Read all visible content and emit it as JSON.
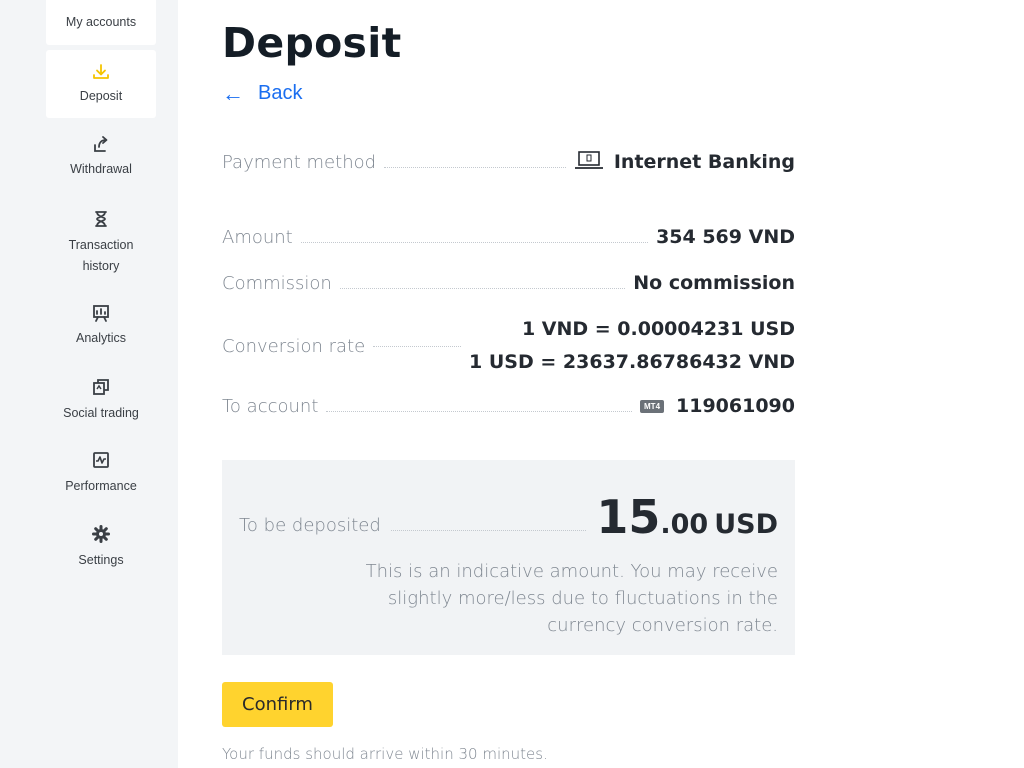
{
  "sidebar": {
    "items": [
      {
        "label": "My accounts",
        "icon": "accounts-icon"
      },
      {
        "label": "Deposit",
        "icon": "deposit-icon",
        "active": true
      },
      {
        "label": "Withdrawal",
        "icon": "withdrawal-icon"
      },
      {
        "label": "Transaction history",
        "icon": "hourglass-icon"
      },
      {
        "label": "Analytics",
        "icon": "analytics-icon"
      },
      {
        "label": "Social trading",
        "icon": "social-trading-icon"
      },
      {
        "label": "Performance",
        "icon": "performance-icon"
      },
      {
        "label": "Settings",
        "icon": "gear-icon"
      }
    ]
  },
  "page": {
    "title": "Deposit",
    "back_label": "Back"
  },
  "details": {
    "payment_method_label": "Payment method",
    "payment_method_value": "Internet Banking",
    "amount_label": "Amount",
    "amount_value": "354 569 VND",
    "commission_label": "Commission",
    "commission_value": "No commission",
    "conversion_label": "Conversion rate",
    "conversion_line1": "1 VND = 0.00004231 USD",
    "conversion_line2": "1 USD = 23637.86786432 VND",
    "to_account_label": "To account",
    "to_account_badge": "MT4",
    "to_account_value": "119061090"
  },
  "summary": {
    "label": "To be deposited",
    "amount_int": "15",
    "amount_dec": ".00",
    "currency": "USD",
    "note": "This is an indicative amount. You may receive slightly more/less due to fluctuations in the currency conversion rate."
  },
  "actions": {
    "confirm_label": "Confirm",
    "footnote": "Your funds should arrive within 30 minutes."
  },
  "colors": {
    "accent_yellow": "#ffd32e",
    "icon_yellow": "#f5c400",
    "link_blue": "#1a6ef0",
    "sidebar_bg": "#f3f5f7",
    "summary_bg": "#f1f3f5"
  }
}
